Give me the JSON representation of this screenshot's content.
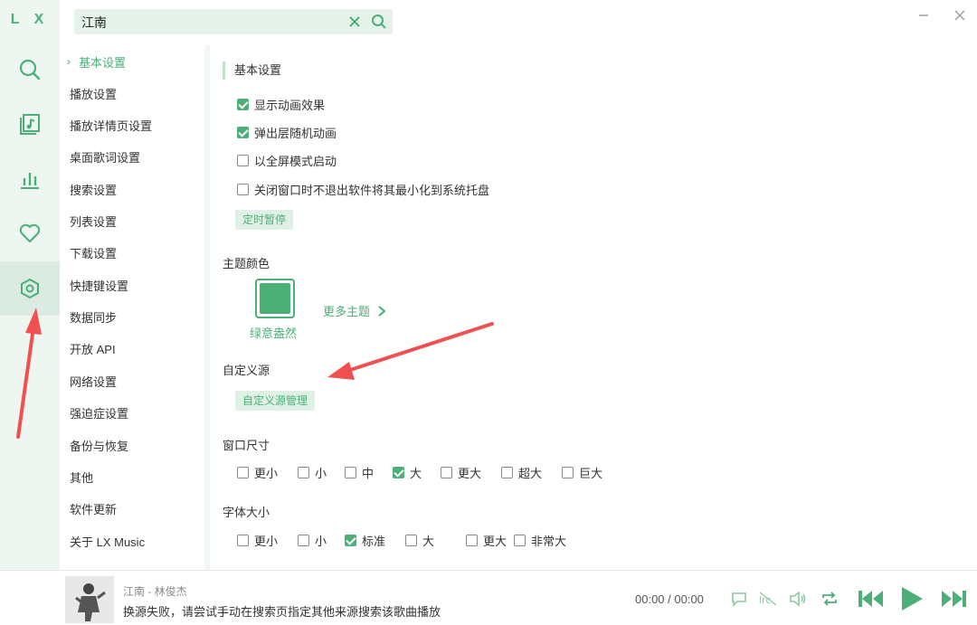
{
  "app": {
    "logo": "L X"
  },
  "rail": {
    "items": [
      {
        "icon": "search-icon"
      },
      {
        "icon": "music-list-icon"
      },
      {
        "icon": "chart-icon"
      },
      {
        "icon": "heart-icon"
      },
      {
        "icon": "settings-icon",
        "active": true
      }
    ]
  },
  "search": {
    "value": "江南"
  },
  "nav": {
    "items": [
      {
        "label": "基本设置",
        "active": true
      },
      {
        "label": "播放设置"
      },
      {
        "label": "播放详情页设置"
      },
      {
        "label": "桌面歌词设置"
      },
      {
        "label": "搜索设置"
      },
      {
        "label": "列表设置"
      },
      {
        "label": "下载设置"
      },
      {
        "label": "快捷键设置"
      },
      {
        "label": "数据同步"
      },
      {
        "label": "开放 API"
      },
      {
        "label": "网络设置"
      },
      {
        "label": "强迫症设置"
      },
      {
        "label": "备份与恢复"
      },
      {
        "label": "其他"
      },
      {
        "label": "软件更新"
      },
      {
        "label": "关于 LX Music"
      }
    ]
  },
  "basic": {
    "title": "基本设置",
    "options": [
      {
        "label": "显示动画效果",
        "checked": true
      },
      {
        "label": "弹出层随机动画",
        "checked": true
      },
      {
        "label": "以全屏模式启动",
        "checked": false
      },
      {
        "label": "关闭窗口时不退出软件将其最小化到系统托盘",
        "checked": false
      }
    ],
    "timer_button": "定时暂停"
  },
  "theme": {
    "title": "主题颜色",
    "current": "绿意盎然",
    "more": "更多主题",
    "accent": "#4caf78"
  },
  "custom_source": {
    "title": "自定义源",
    "button": "自定义源管理"
  },
  "window_size": {
    "title": "窗口尺寸",
    "options": [
      {
        "label": "更小",
        "checked": false
      },
      {
        "label": "小",
        "checked": false
      },
      {
        "label": "中",
        "checked": false
      },
      {
        "label": "大",
        "checked": true
      },
      {
        "label": "更大",
        "checked": false
      },
      {
        "label": "超大",
        "checked": false
      },
      {
        "label": "巨大",
        "checked": false
      }
    ]
  },
  "font_size": {
    "title": "字体大小",
    "options": [
      {
        "label": "更小",
        "checked": false
      },
      {
        "label": "小",
        "checked": false
      },
      {
        "label": "标准",
        "checked": true
      },
      {
        "label": "大",
        "checked": false
      },
      {
        "label": "更大",
        "checked": false
      },
      {
        "label": "非常大",
        "checked": false
      }
    ]
  },
  "player": {
    "title": "江南 - 林俊杰",
    "message": "换源失败，请尝试手动在搜索页指定其他来源搜索该歌曲播放",
    "time": "00:00 / 00:00"
  }
}
